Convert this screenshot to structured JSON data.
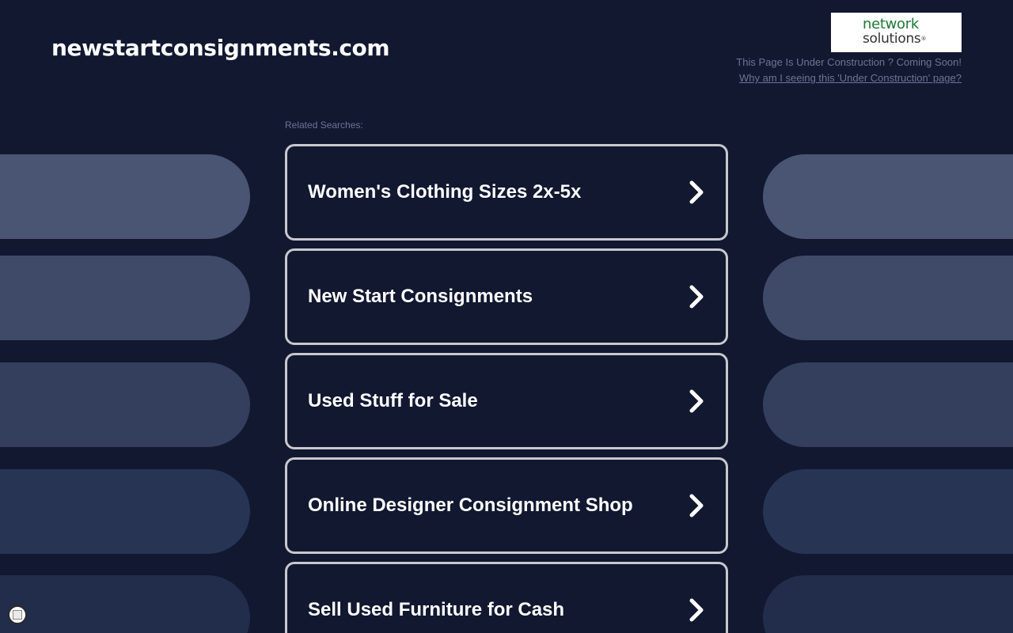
{
  "header": {
    "domain": "newstartconsignments.com",
    "logo": {
      "line1": "network",
      "line2": "solutions",
      "registered_mark": "®"
    },
    "construction_text": "This Page Is Under Construction ? Coming Soon!",
    "construction_link": "Why am I seeing this 'Under Construction' page?"
  },
  "related": {
    "label": "Related Searches:",
    "items": [
      {
        "label": "Women's Clothing Sizes 2x-5x",
        "icon": "chevron-right-icon"
      },
      {
        "label": "New Start Consignments",
        "icon": "chevron-right-icon"
      },
      {
        "label": "Used Stuff for Sale",
        "icon": "chevron-right-icon"
      },
      {
        "label": "Online Designer Consignment Shop",
        "icon": "chevron-right-icon"
      },
      {
        "label": "Sell Used Furniture for Cash",
        "icon": "chevron-right-icon"
      }
    ]
  },
  "colors": {
    "background": "#111830",
    "card_border": "#c8c8cc",
    "muted_text": "#6d7590",
    "logo_green": "#1e7a34"
  }
}
